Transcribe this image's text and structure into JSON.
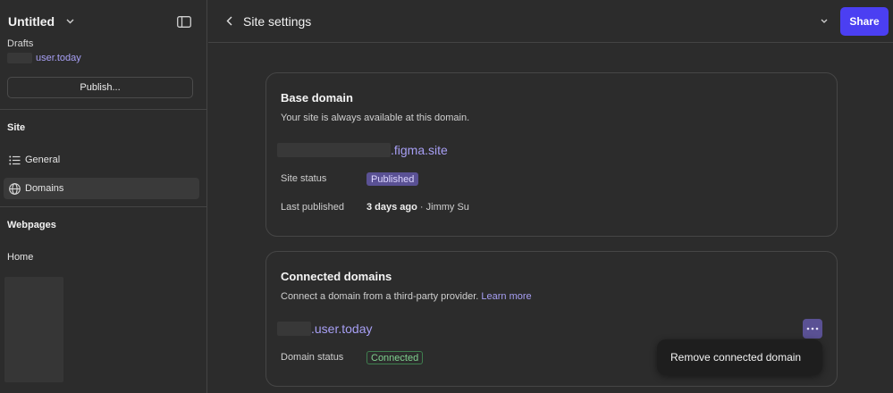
{
  "sidebar": {
    "file_name": "Untitled",
    "drafts_label": "Drafts",
    "user_url": "user.today",
    "publish_label": "Publish...",
    "site_section": "Site",
    "nav": [
      {
        "label": "General",
        "icon": "list-icon"
      },
      {
        "label": "Domains",
        "icon": "globe-icon"
      }
    ],
    "webpages_section": "Webpages",
    "home_label": "Home"
  },
  "topbar": {
    "title": "Site settings",
    "share_label": "Share"
  },
  "base_domain": {
    "title": "Base domain",
    "subtitle": "Your site is always available at this domain.",
    "domain_suffix": ".figma.site",
    "status_label": "Site status",
    "status_value": "Published",
    "last_published_label": "Last published",
    "last_published_time": "3 days ago",
    "last_published_by": " · Jimmy Su"
  },
  "connected_domains": {
    "title": "Connected domains",
    "subtitle": "Connect a domain from a third-party provider.",
    "learn_more": "Learn more",
    "domain_suffix": ".user.today",
    "status_label": "Domain status",
    "status_value": "Connected"
  },
  "context_menu": {
    "remove_label": "Remove connected domain"
  },
  "colors": {
    "accent": "#4b3ff2",
    "link": "#a79ff4",
    "connected": "#7fd08f"
  }
}
